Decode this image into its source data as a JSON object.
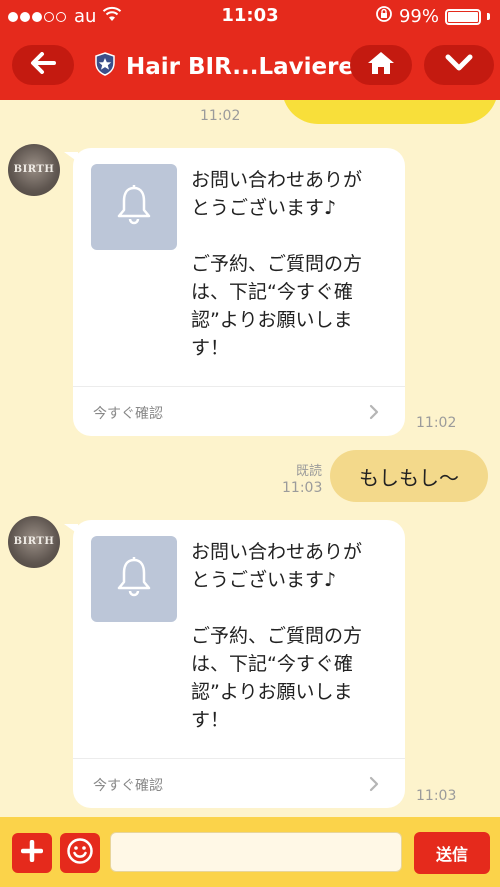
{
  "status_bar": {
    "carrier": "au",
    "time": "11:03",
    "battery": "99%",
    "signal_dots": 3,
    "signal_dots_total": 5,
    "battery_level": 0.99
  },
  "header": {
    "title": "Hair BIR...Laviere"
  },
  "messages": [
    {
      "kind": "incoming-sticker",
      "time": "11:02"
    },
    {
      "kind": "incoming-card",
      "avatar_text": "BIRTH",
      "lines": [
        "お問い合わせありがとうございます♪",
        "ご予約、ご質問の方は、下記“今すぐ確認”よりお願いします！"
      ],
      "line_breaks": [
        [
          "お問い合わせありが",
          "とうございます♪"
        ],
        [
          "ご予約、ご質問の方",
          "は、下記“今すぐ確",
          "認”よりお願いしま",
          "す！"
        ]
      ],
      "link": "今すぐ確認",
      "time": "11:02"
    },
    {
      "kind": "outgoing",
      "text": "もしもし〜",
      "read": "既読",
      "time": "11:03"
    },
    {
      "kind": "incoming-card",
      "avatar_text": "BIRTH",
      "lines": [
        "お問い合わせありがとうございます♪",
        "ご予約、ご質問の方は、下記“今すぐ確認”よりお願いします！"
      ],
      "line_breaks": [
        [
          "お問い合わせありが",
          "とうございます♪"
        ],
        [
          "ご予約、ご質問の方",
          "は、下記“今すぐ確",
          "認”よりお願いしま",
          "す！"
        ]
      ],
      "link": "今すぐ確認",
      "time": "11:03"
    }
  ],
  "input_bar": {
    "placeholder": "",
    "send_label": "送信"
  },
  "colors": {
    "header_red": "#e52a1c",
    "chat_bg": "#fdf3cc",
    "input_bar_bg": "#fbd34a",
    "outgoing_bubble": "#f3d98b",
    "card_image_bg": "#bcc6d8"
  },
  "icons": [
    "back-arrow-icon",
    "shield-star-icon",
    "home-icon",
    "chevron-down-icon",
    "bell-icon",
    "chevron-right-icon",
    "plus-icon",
    "smiley-icon",
    "wifi-icon",
    "orientation-lock-icon"
  ]
}
